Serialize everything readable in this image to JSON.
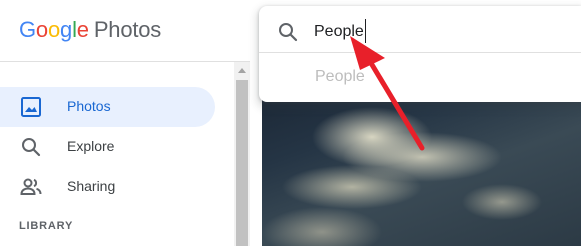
{
  "brand": {
    "google": [
      "G",
      "o",
      "o",
      "g",
      "l",
      "e"
    ],
    "google_colors": [
      "#4285F4",
      "#EA4335",
      "#FBBC05",
      "#4285F4",
      "#34A853",
      "#EA4335"
    ],
    "product": "Photos"
  },
  "search": {
    "value": "People",
    "suggestion": "People"
  },
  "sidebar": {
    "items": [
      {
        "label": "Photos",
        "icon": "photo-icon",
        "active": true
      },
      {
        "label": "Explore",
        "icon": "search-icon",
        "active": false
      },
      {
        "label": "Sharing",
        "icon": "people-icon",
        "active": false
      }
    ],
    "section": "LIBRARY"
  },
  "colors": {
    "accent": "#1967d2",
    "active_bg": "#e8f0fe",
    "annotation": "#e8202a"
  }
}
